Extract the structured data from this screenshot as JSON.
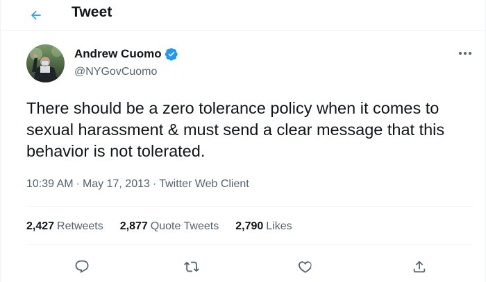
{
  "header": {
    "title": "Tweet",
    "back_icon": "arrow-left-icon"
  },
  "author": {
    "name": "Andrew Cuomo",
    "handle": "@NYGovCuomo",
    "verified": true,
    "verified_icon": "verified-badge-icon"
  },
  "tweet": {
    "text": "There should be a zero tolerance policy when it comes to sexual harassment & must send a clear message that this behavior is not tolerated.",
    "time": "10:39 AM",
    "date": "May 17, 2013",
    "source": "Twitter Web Client",
    "separator": "·"
  },
  "stats": {
    "retweets_count": "2,427",
    "retweets_label": "Retweets",
    "quotes_count": "2,877",
    "quotes_label": "Quote Tweets",
    "likes_count": "2,790",
    "likes_label": "Likes"
  },
  "actions": {
    "reply_icon": "reply-icon",
    "retweet_icon": "retweet-icon",
    "like_icon": "heart-icon",
    "share_icon": "share-icon",
    "more_icon": "more-options-icon"
  },
  "colors": {
    "accent": "#1d9bf0",
    "text_primary": "#0f1419",
    "text_secondary": "#536471",
    "border": "#eff3f4"
  }
}
